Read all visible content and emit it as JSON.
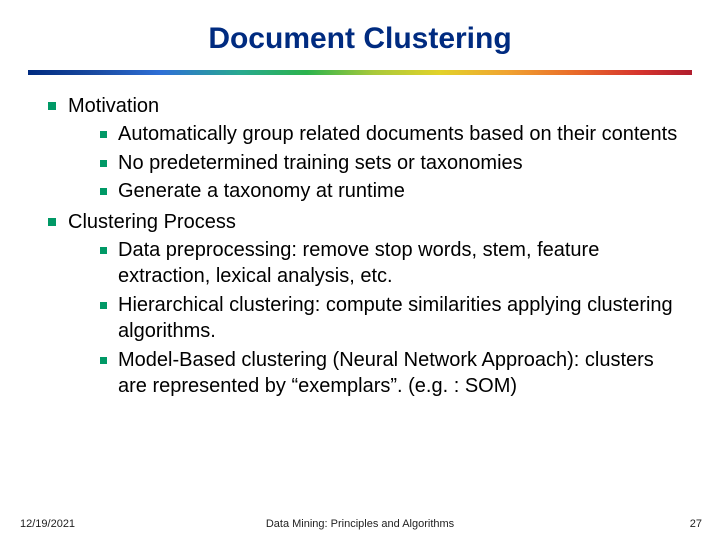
{
  "title": "Document Clustering",
  "bullets": [
    {
      "label": "Motivation",
      "items": [
        "Automatically group related documents based on their contents",
        "No predetermined training sets or taxonomies",
        "Generate a taxonomy at runtime"
      ]
    },
    {
      "label": "Clustering Process",
      "items": [
        "Data preprocessing: remove stop words, stem, feature extraction, lexical analysis, etc.",
        "Hierarchical clustering: compute similarities applying clustering algorithms.",
        "Model-Based clustering (Neural Network Approach): clusters are represented by “exemplars”. (e.g. : SOM)"
      ]
    }
  ],
  "footer": {
    "date": "12/19/2021",
    "center": "Data Mining: Principles and Algorithms",
    "page": "27"
  }
}
